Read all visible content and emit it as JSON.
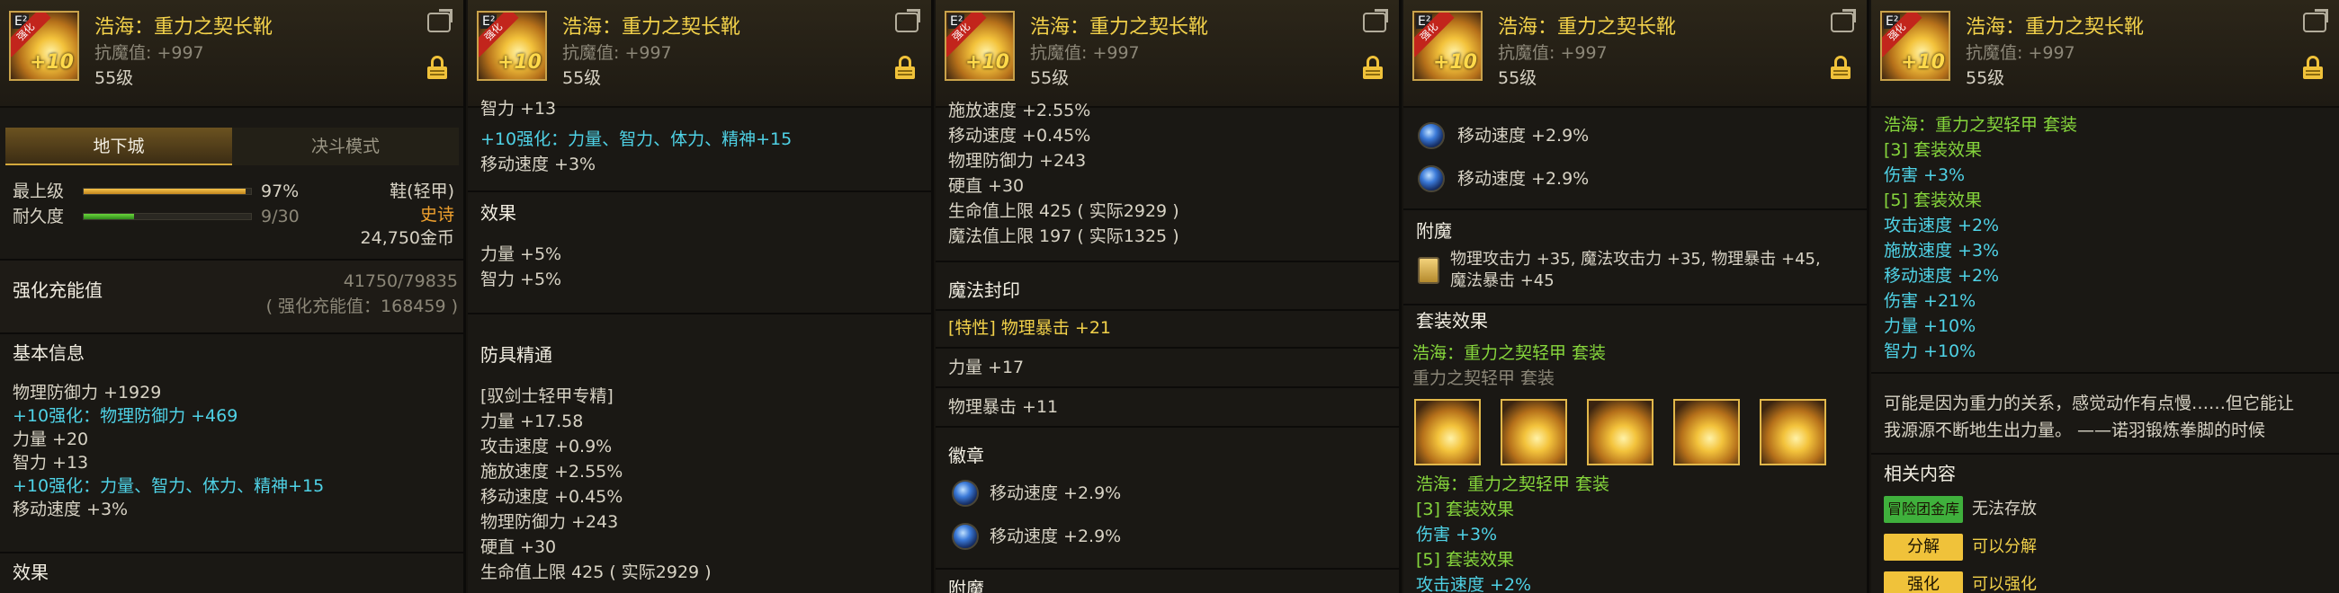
{
  "item": {
    "name": "浩海：重力之契长靴",
    "resist": "抗魔值: +997",
    "level": "55级",
    "icon_label": "E²",
    "icon_ribbon": "强化",
    "icon_plus": "+10"
  },
  "p1": {
    "tabs": [
      "地下城",
      "决斗模式"
    ],
    "max_label": "最上级",
    "max_pct": "97%",
    "max_fill": 0.97,
    "dur_label": "耐久度",
    "dur_val": "9/30",
    "dur_fill": 0.3,
    "type": "鞋(轻甲)",
    "rarity": "史诗",
    "price": "24,750金币",
    "charge_label": "强化充能值",
    "charge_val": "41750/79835",
    "charge_sub": "( 强化充能值：168459 )",
    "basic_title": "基本信息",
    "basic": [
      "物理防御力 +1929",
      "+10强化：物理防御力 +469",
      "力量 +20",
      "智力 +13",
      "+10强化：力量、智力、体力、精神+15",
      "移动速度 +3%"
    ],
    "effect_title": "效果"
  },
  "p2": {
    "top_partial": "智力 +13",
    "lines": [
      "+10强化：力量、智力、体力、精神+15",
      "移动速度 +3%"
    ],
    "effect_title": "效果",
    "effects": [
      "力量 +5%",
      "智力 +5%"
    ],
    "mastery_title": "防具精通",
    "mastery": [
      "[驭剑士轻甲专精]",
      "力量 +17.58",
      "攻击速度 +0.9%",
      "施放速度 +2.55%",
      "移动速度 +0.45%",
      "物理防御力 +243",
      "硬直 +30",
      "生命值上限 425 ( 实际2929 )"
    ]
  },
  "p3": {
    "lines": [
      "施放速度 +2.55%",
      "移动速度 +0.45%",
      "物理防御力 +243",
      "硬直 +30",
      "生命值上限 425 ( 实际2929 )",
      "魔法值上限 197 ( 实际1325 )"
    ],
    "seal_title": "魔法封印",
    "seal": [
      "[特性] 物理暴击 +21",
      "力量 +17",
      "物理暴击 +11"
    ],
    "emblem_title": "徽章",
    "emblems": [
      "移动速度 +2.9%",
      "移动速度 +2.9%"
    ],
    "enchant_partial": "附魔"
  },
  "p4": {
    "emblems": [
      "移动速度 +2.9%",
      "移动速度 +2.9%"
    ],
    "enchant_title": "附魔",
    "enchant": [
      "物理攻击力 +35, 魔法攻击力 +35, 物理暴击 +45,",
      "魔法暴击 +45"
    ],
    "set_title": "套装效果",
    "set_name": "浩海：重力之契轻甲 套装",
    "set_sub": "重力之契轻甲 套装",
    "set2_name": "浩海：重力之契轻甲 套装",
    "set2": [
      "[3] 套装效果",
      "伤害 +3%",
      "[5] 套装效果",
      "攻击速度 +2%"
    ]
  },
  "p5": {
    "set_name": "浩海：重力之契轻甲 套装",
    "set": [
      "[3] 套装效果",
      "伤害 +3%",
      "[5] 套装效果",
      "攻击速度 +2%",
      "施放速度 +3%",
      "移动速度 +2%",
      "伤害 +21%",
      "力量 +10%",
      "智力 +10%"
    ],
    "flavor": [
      "可能是因为重力的关系，感觉动作有点慢……但它能让",
      "我源源不断地生出力量。 ——诺羽锻炼拳脚的时候"
    ],
    "related_title": "相关内容",
    "related": [
      {
        "btn": "冒险团金库",
        "text": "无法存放",
        "color": "#3fb03c"
      },
      {
        "btn": "分解",
        "text": "可以分解",
        "color": "#f0c23a"
      },
      {
        "btn": "强化",
        "text": "可以强化",
        "color": "#f0c23a"
      }
    ]
  }
}
